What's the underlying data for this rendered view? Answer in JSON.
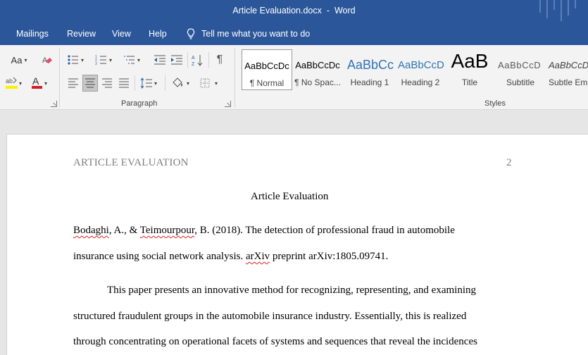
{
  "window": {
    "doc_name": "Article Evaluation.docx",
    "separator": "-",
    "app_name": "Word"
  },
  "menu": {
    "items": [
      "Mailings",
      "Review",
      "View",
      "Help"
    ],
    "tell_me": "Tell me what you want to do"
  },
  "ribbon": {
    "font_size_button": "Aa",
    "groups": {
      "paragraph": "Paragraph",
      "styles": "Styles"
    },
    "styles": [
      {
        "sample": "AaBbCcDc",
        "name": "¶ Normal",
        "color": "#000000"
      },
      {
        "sample": "AaBbCcDc",
        "name": "¶ No Spac...",
        "color": "#000000"
      },
      {
        "sample": "AaBbCc",
        "name": "Heading 1",
        "color": "#2e74b5"
      },
      {
        "sample": "AaBbCcD",
        "name": "Heading 2",
        "color": "#2e74b5"
      },
      {
        "sample": "AaB",
        "name": "Title",
        "color": "#000000"
      },
      {
        "sample": "AaBbCcD",
        "name": "Subtitle",
        "color": "#5a5a5a"
      },
      {
        "sample": "AaBbCcD",
        "name": "Subtle Em...",
        "color": "#404040"
      }
    ]
  },
  "document": {
    "header_text": "ARTICLE EVALUATION",
    "page_number": "2",
    "title": "Article Evaluation",
    "reference": {
      "author1": "Bodaghi",
      "part1": ", A., & ",
      "author2": "Teimourpour",
      "part2": ", B. (2018). The detection of professional fraud in automobile",
      "line2_start": "insurance using social network analysis. ",
      "arxiv": "arXiv",
      "line2_end": " preprint arXiv:1805.09741."
    },
    "body_lines": [
      "This paper presents an innovative method for recognizing, representing, and examining",
      "structured fraudulent groups in the automobile insurance industry. Essentially, this is realized",
      "through concentrating on operational facets of systems and sequences that reveal the incidences"
    ]
  }
}
